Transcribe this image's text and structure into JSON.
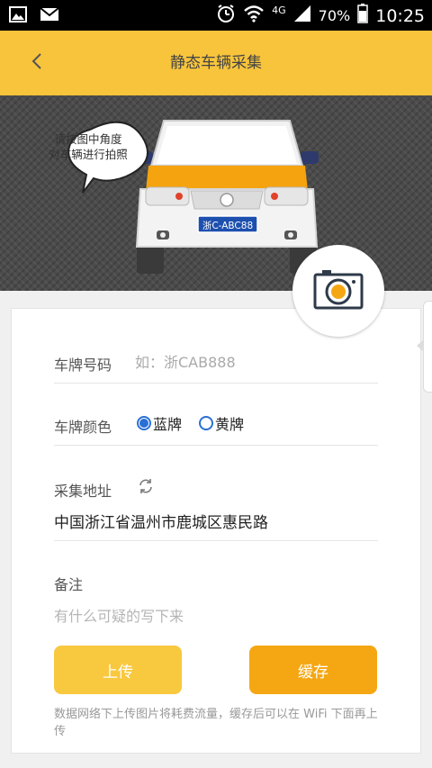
{
  "status_bar": {
    "network": "4G",
    "battery": "70%",
    "time": "10:25",
    "left_icons": [
      "image-icon",
      "mail-icon"
    ],
    "right_icons": [
      "alarm-icon",
      "wifi-icon",
      "signal-icon",
      "battery-icon"
    ]
  },
  "header": {
    "title": "静态车辆采集",
    "back_icon": "chevron-left-icon",
    "background": "#f7c43c"
  },
  "hero": {
    "bubble_text_line1": "请按图中角度",
    "bubble_text_line2": "对车辆进行拍照",
    "plate": "浙C-ABC88",
    "camera_icon": "camera-icon"
  },
  "form": {
    "plate_label": "车牌号码",
    "plate_placeholder": "如：浙CAB888",
    "color_label": "车牌颜色",
    "color_options": [
      {
        "label": "蓝牌",
        "checked": true
      },
      {
        "label": "黄牌",
        "checked": false
      }
    ],
    "address_label": "采集地址",
    "address_value": "中国浙江省温州市鹿城区惠民路",
    "refresh_icon": "refresh-icon",
    "remark_label": "备注",
    "remark_placeholder": "有什么可疑的写下来"
  },
  "actions": {
    "upload_label": "上传",
    "cache_label": "缓存"
  },
  "footnote": "数据网络下上传图片将耗费流量，缓存后可以在 WiFi 下面再上传",
  "colors": {
    "accent_yellow": "#f8c83f",
    "accent_orange": "#f5a713",
    "radio_blue": "#2a6fd6"
  }
}
